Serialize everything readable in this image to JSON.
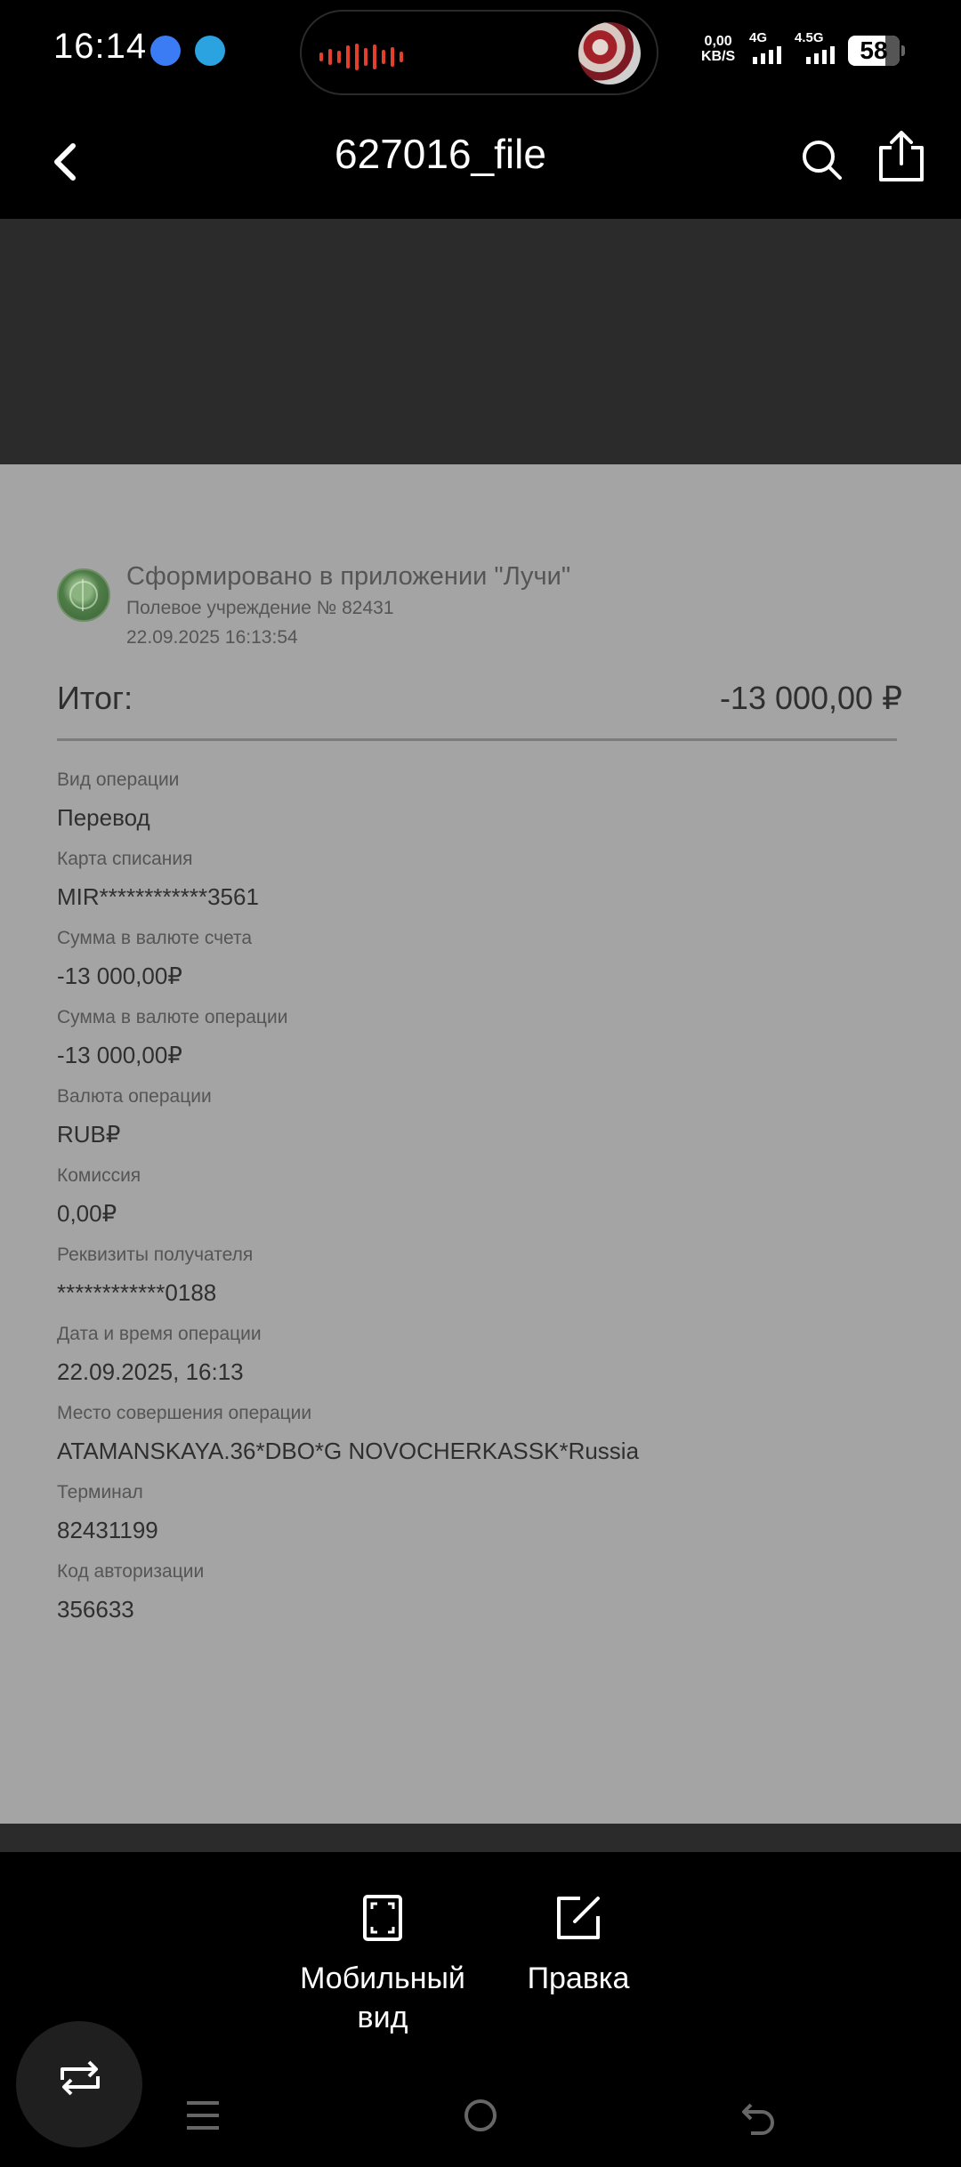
{
  "status_bar": {
    "time": "16:14",
    "net_speed_value": "0,00",
    "net_speed_unit": "KB/S",
    "signal1_label": "4G",
    "signal2_label": "4.5G",
    "battery": "58"
  },
  "header": {
    "title": "627016_file"
  },
  "receipt": {
    "generated_title": "Сформировано в приложении \"Лучи\"",
    "institution": "Полевое учреждение № 82431",
    "datetime": "22.09.2025 16:13:54",
    "total_label": "Итог:",
    "total_value": "-13 000,00 ₽",
    "fields": [
      {
        "label": "Вид операции",
        "value": "Перевод"
      },
      {
        "label": "Карта списания",
        "value": "MIR************3561"
      },
      {
        "label": "Сумма в валюте счета",
        "value": "-13 000,00₽"
      },
      {
        "label": "Сумма в валюте операции",
        "value": "-13 000,00₽"
      },
      {
        "label": "Валюта операции",
        "value": "RUB₽"
      },
      {
        "label": "Комиссия",
        "value": "0,00₽"
      },
      {
        "label": "Реквизиты получателя",
        "value": "************0188"
      },
      {
        "label": "Дата и время операции",
        "value": "22.09.2025, 16:13"
      },
      {
        "label": "Место совершения операции",
        "value": "ATAMANSKAYA.36*DBO*G NOVOCHERKASSK*Russia"
      },
      {
        "label": "Терминал",
        "value": "82431199"
      },
      {
        "label": "Код авторизации",
        "value": "356633"
      }
    ]
  },
  "toolbar": {
    "mobile_view_line1": "Мобильный",
    "mobile_view_line2": "вид",
    "edit_label": "Правка"
  },
  "icons": {
    "back": "chevron-left-icon",
    "search": "search-icon",
    "share": "share-icon",
    "mobile_view": "expand-frame-icon",
    "edit": "edit-icon",
    "rotate": "rotate-icon",
    "nav_menu": "menu-icon",
    "nav_home": "home-icon",
    "nav_back": "back-icon"
  },
  "colors": {
    "document_bg": "#a4a4a4",
    "toolbar_bg": "#000000",
    "wave": "#e2402c"
  }
}
